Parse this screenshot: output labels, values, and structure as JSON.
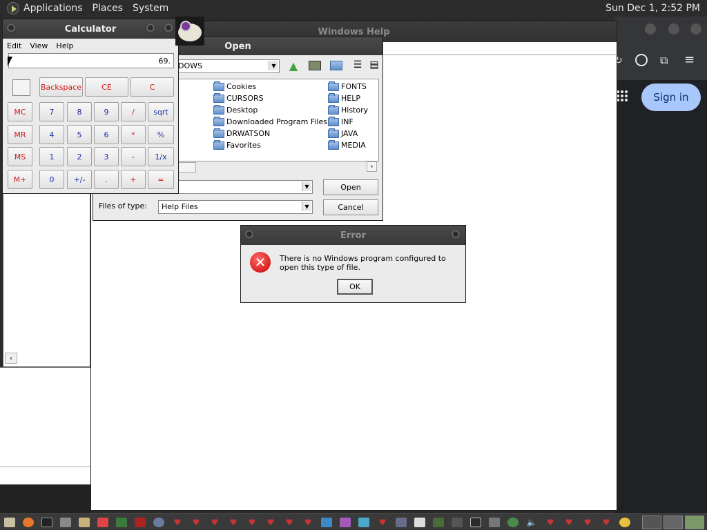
{
  "top_panel": {
    "menus": [
      "Applications",
      "Places",
      "System"
    ],
    "clock": "Sun Dec  1,  2:52 PM"
  },
  "browser": {
    "signin_label": "Sign in"
  },
  "help_window": {
    "title": "Windows Help"
  },
  "calculator": {
    "title": "Calculator",
    "menu": [
      "Edit",
      "View",
      "Help"
    ],
    "display_value": "69.",
    "top_buttons": [
      "Backspace",
      "CE",
      "C"
    ],
    "memory_buttons": [
      "MC",
      "MR",
      "MS",
      "M+"
    ],
    "rows": [
      [
        "7",
        "8",
        "9",
        "/",
        "sqrt"
      ],
      [
        "4",
        "5",
        "6",
        "*",
        "%"
      ],
      [
        "1",
        "2",
        "3",
        "-",
        "1/x"
      ],
      [
        "0",
        "+/-",
        ".",
        "+",
        "="
      ]
    ]
  },
  "open_dialog": {
    "title": "Open",
    "look_in_value": "DOWS",
    "files_col1": [
      "Cookies",
      "CURSORS",
      "Desktop",
      "Downloaded Program Files",
      "DRWATSON",
      "Favorites"
    ],
    "files_col2": [
      "FONTS",
      "HELP",
      "History",
      "INF",
      "JAVA",
      "MEDIA"
    ],
    "file_name_value": "",
    "files_of_type_label": "Files of type:",
    "files_of_type_value": "Help Files",
    "open_label": "Open",
    "cancel_label": "Cancel"
  },
  "error_dialog": {
    "title": "Error",
    "message": "There is no Windows program configured to open this type of file.",
    "ok_label": "OK"
  },
  "icons": {
    "up": "arrow-up-icon",
    "folder": "folder-icon",
    "error": "error-icon"
  }
}
